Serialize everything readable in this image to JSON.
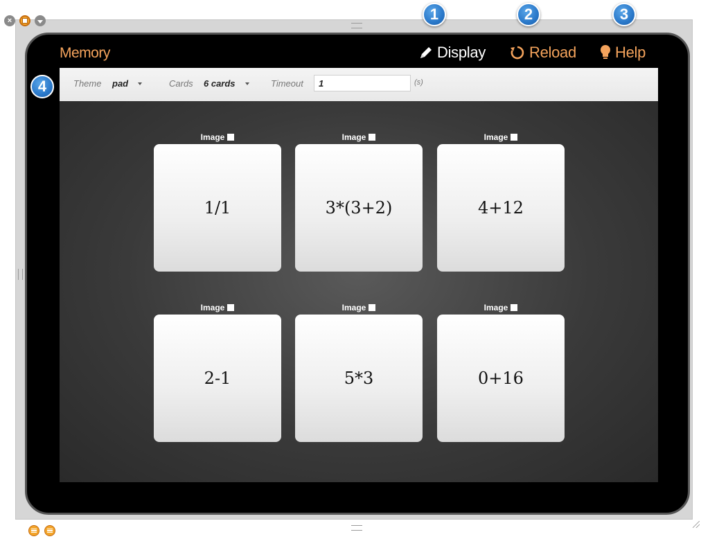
{
  "app": {
    "title": "Memory"
  },
  "nav": {
    "display_label": "Display",
    "reload_label": "Reload",
    "help_label": "Help"
  },
  "badges": [
    "1",
    "2",
    "3",
    "4"
  ],
  "toolbar": {
    "theme_label": "Theme",
    "theme_value": "pad",
    "cards_label": "Cards",
    "cards_value": "6 cards",
    "timeout_label": "Timeout",
    "timeout_value": "1",
    "timeout_unit": "(s)"
  },
  "cards": [
    {
      "toggle_label": "Image",
      "value": "1/1"
    },
    {
      "toggle_label": "Image",
      "value": "3*(3+2)"
    },
    {
      "toggle_label": "Image",
      "value": "4+12"
    },
    {
      "toggle_label": "Image",
      "value": "2-1"
    },
    {
      "toggle_label": "Image",
      "value": "5*3"
    },
    {
      "toggle_label": "Image",
      "value": "0+16"
    }
  ],
  "colors": {
    "accent": "#f4a35c",
    "badge": "#2a78c9",
    "orange_button": "#f3a52b"
  },
  "icons": [
    "close-icon",
    "restore-icon",
    "collapse-icon",
    "pencil-icon",
    "reload-icon",
    "lightbulb-icon",
    "menu-icon"
  ]
}
